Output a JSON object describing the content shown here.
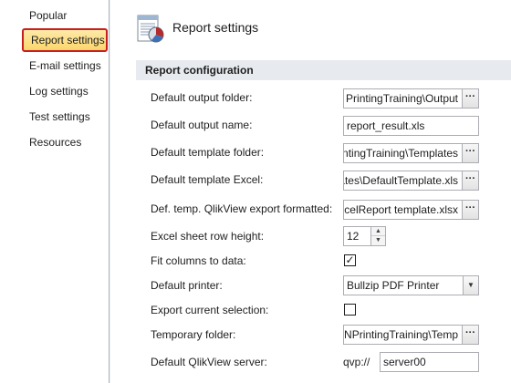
{
  "sidebar": {
    "items": [
      {
        "label": "Popular"
      },
      {
        "label": "Report settings"
      },
      {
        "label": "E-mail settings"
      },
      {
        "label": "Log settings"
      },
      {
        "label": "Test settings"
      },
      {
        "label": "Resources"
      }
    ],
    "active_index": 1
  },
  "header": {
    "title": "Report settings",
    "icon": "report-settings-icon"
  },
  "section": {
    "title": "Report configuration"
  },
  "fields": {
    "output_folder": {
      "label": "Default output folder:",
      "value": "PrintingTraining\\Output",
      "button": "···"
    },
    "output_name": {
      "label": "Default output name:",
      "value": "report_result.xls"
    },
    "template_folder": {
      "label": "Default template folder:",
      "value": "ntingTraining\\Templates",
      "button": "···"
    },
    "template_excel": {
      "label": "Default template Excel:",
      "value": "ates\\DefaultTemplate.xls",
      "button": "···"
    },
    "qv_export": {
      "label": "Def. temp. QlikView export formatted:",
      "value": "xcelReport template.xlsx",
      "button": "···"
    },
    "row_height": {
      "label": "Excel sheet row height:",
      "value": "12"
    },
    "fit_columns": {
      "label": "Fit columns to data:",
      "checked": true,
      "mark": "✓"
    },
    "printer": {
      "label": "Default printer:",
      "value": "Bullzip PDF Printer"
    },
    "export_selection": {
      "label": "Export current selection:",
      "checked": false,
      "mark": ""
    },
    "temp_folder": {
      "label": "Temporary folder:",
      "value": "NPrintingTraining\\Temp",
      "button": "···"
    },
    "qv_server": {
      "label": "Default QlikView server:",
      "prefix": "qvp://",
      "value": "server00"
    }
  },
  "colors": {
    "active_highlight": "#fbd66c",
    "active_border": "#c81e1e",
    "section_bar": "#e7eaee"
  }
}
